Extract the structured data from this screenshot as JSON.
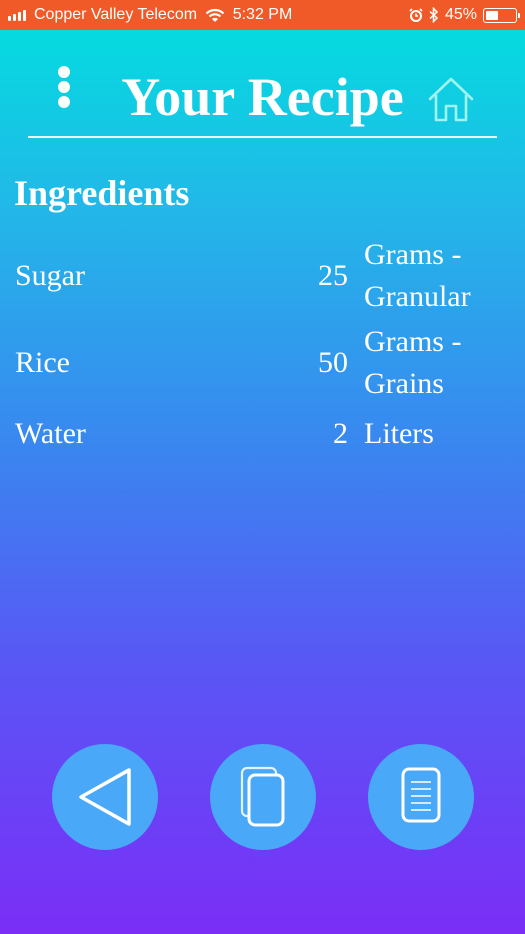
{
  "status_bar": {
    "carrier": "Copper Valley Telecom",
    "time": "5:32 PM",
    "battery_percent": "45%",
    "battery_level": 0.45
  },
  "header": {
    "title": "Your Recipe",
    "menu_icon": "more-vertical-icon",
    "home_icon": "home-icon"
  },
  "ingredients": {
    "title": "Ingredients",
    "items": [
      {
        "name": "Sugar",
        "quantity": "25",
        "unit_line1": "Grams -",
        "unit_line2": "Granular"
      },
      {
        "name": "Rice",
        "quantity": "50",
        "unit_line1": "Grams -",
        "unit_line2": "Grains"
      },
      {
        "name": "Water",
        "quantity": "2",
        "unit_line1": "Liters",
        "unit_line2": ""
      }
    ]
  },
  "bottom_nav": {
    "back_icon": "back-triangle-icon",
    "copy_icon": "copy-icon",
    "document_icon": "document-icon"
  },
  "colors": {
    "status_bar": "#f05a28",
    "button_fill": "#4aa8f8",
    "gradient_top": "#00e0de",
    "gradient_bottom": "#7a2ef6"
  }
}
